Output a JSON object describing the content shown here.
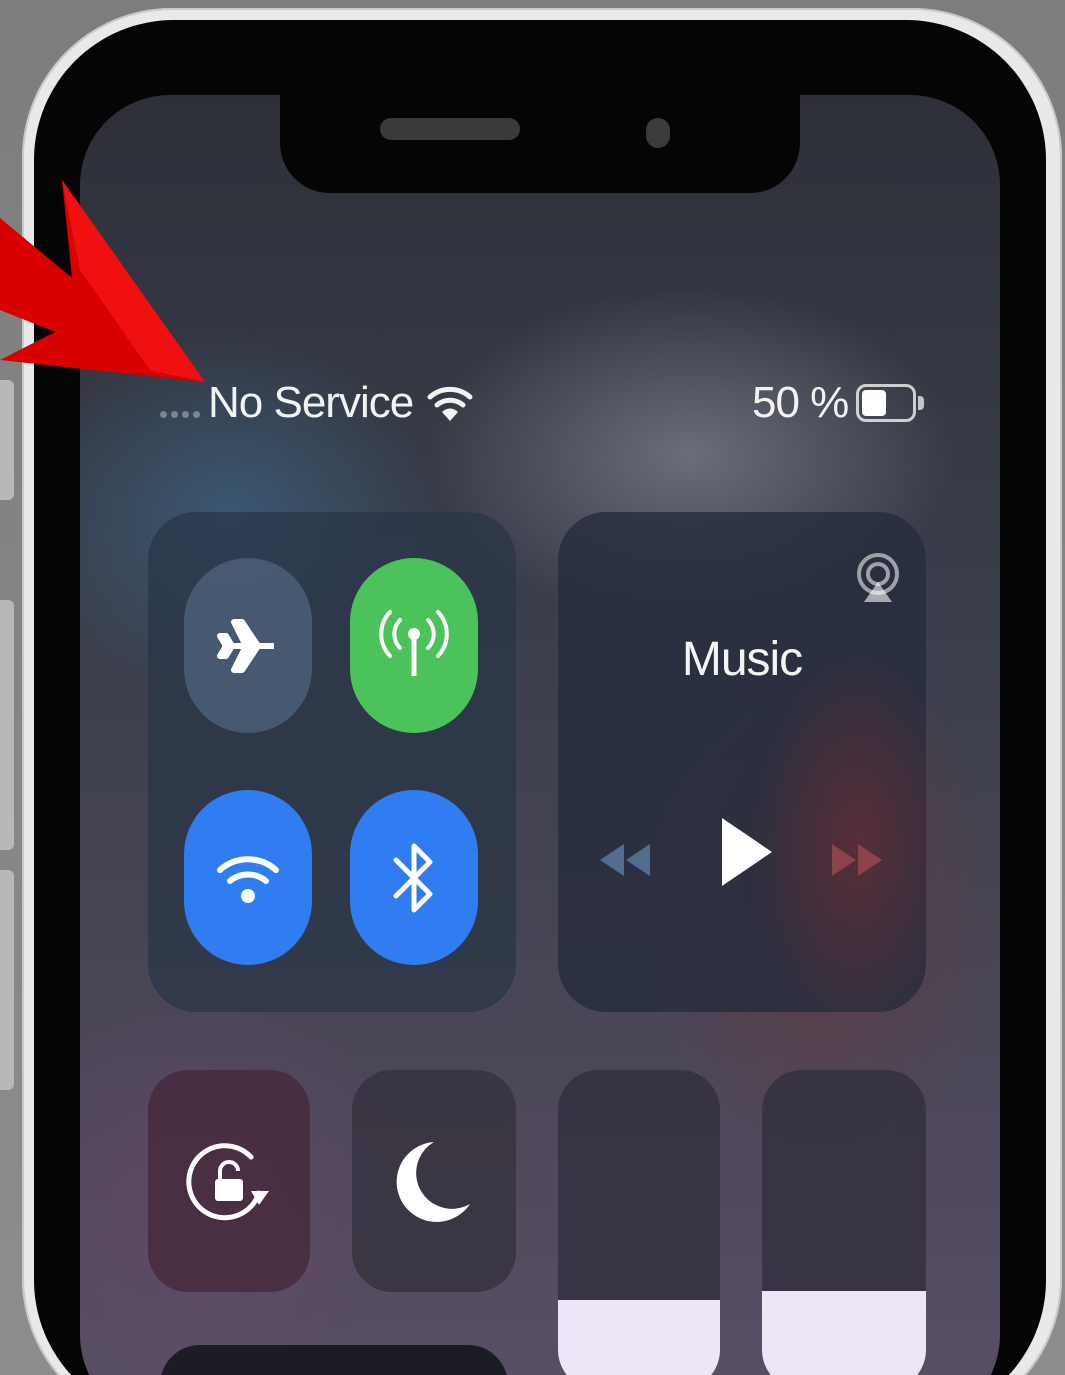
{
  "status_bar": {
    "carrier": "No Service",
    "battery_text": "50 %",
    "battery_level": 0.5,
    "wifi_icon": "wifi-icon"
  },
  "connectivity": {
    "airplane_mode": {
      "icon": "airplane-icon",
      "state": "off"
    },
    "cellular_data": {
      "icon": "cellular-antenna-icon",
      "state": "on",
      "color": "#4cc35a"
    },
    "wifi": {
      "icon": "wifi-icon",
      "state": "on",
      "color": "#2f7df0"
    },
    "bluetooth": {
      "icon": "bluetooth-icon",
      "state": "on",
      "color": "#2f7df0"
    }
  },
  "music": {
    "title": "Music",
    "icons": [
      "airplay-audio-icon",
      "rewind-icon",
      "play-icon",
      "fast-forward-icon"
    ]
  },
  "controls": {
    "rotation_lock": {
      "icon": "rotation-lock-icon"
    },
    "do_not_disturb": {
      "icon": "moon-icon"
    },
    "brightness": {
      "level": 0.28
    },
    "volume": {
      "level": 0.31
    }
  },
  "annotation": {
    "icon": "red-arrow-icon",
    "color": "#e00000"
  }
}
